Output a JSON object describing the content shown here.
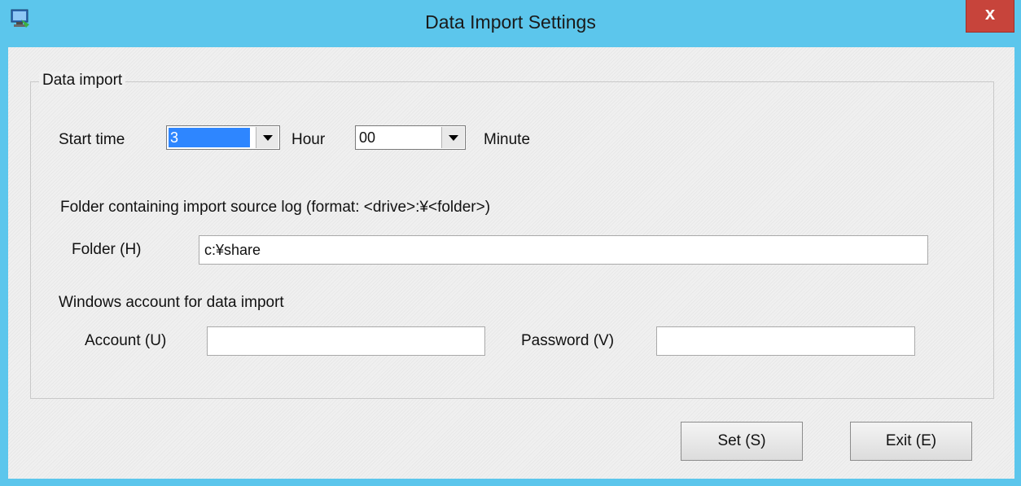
{
  "window": {
    "title": "Data Import Settings",
    "close_label": "x",
    "icon": "app-icon"
  },
  "group": {
    "label": "Data import"
  },
  "start_time": {
    "label": "Start time",
    "hour_value": "3",
    "hour_label": "Hour",
    "minute_value": "00",
    "minute_label": "Minute"
  },
  "folder_section": {
    "caption": "Folder containing import source log (format: <drive>:¥<folder>)",
    "folder_label": "Folder (H)",
    "folder_value": "c:¥share"
  },
  "account_section": {
    "caption": "Windows account for data import",
    "account_label": "Account (U)",
    "account_value": "",
    "password_label": "Password (V)",
    "password_value": ""
  },
  "buttons": {
    "set_label": "Set (S)",
    "exit_label": "Exit (E)"
  },
  "colors": {
    "titlebar": "#5cc6ec",
    "close_button": "#c7443b",
    "selection": "#2e86ff",
    "client_bg": "#f0f0f0"
  }
}
